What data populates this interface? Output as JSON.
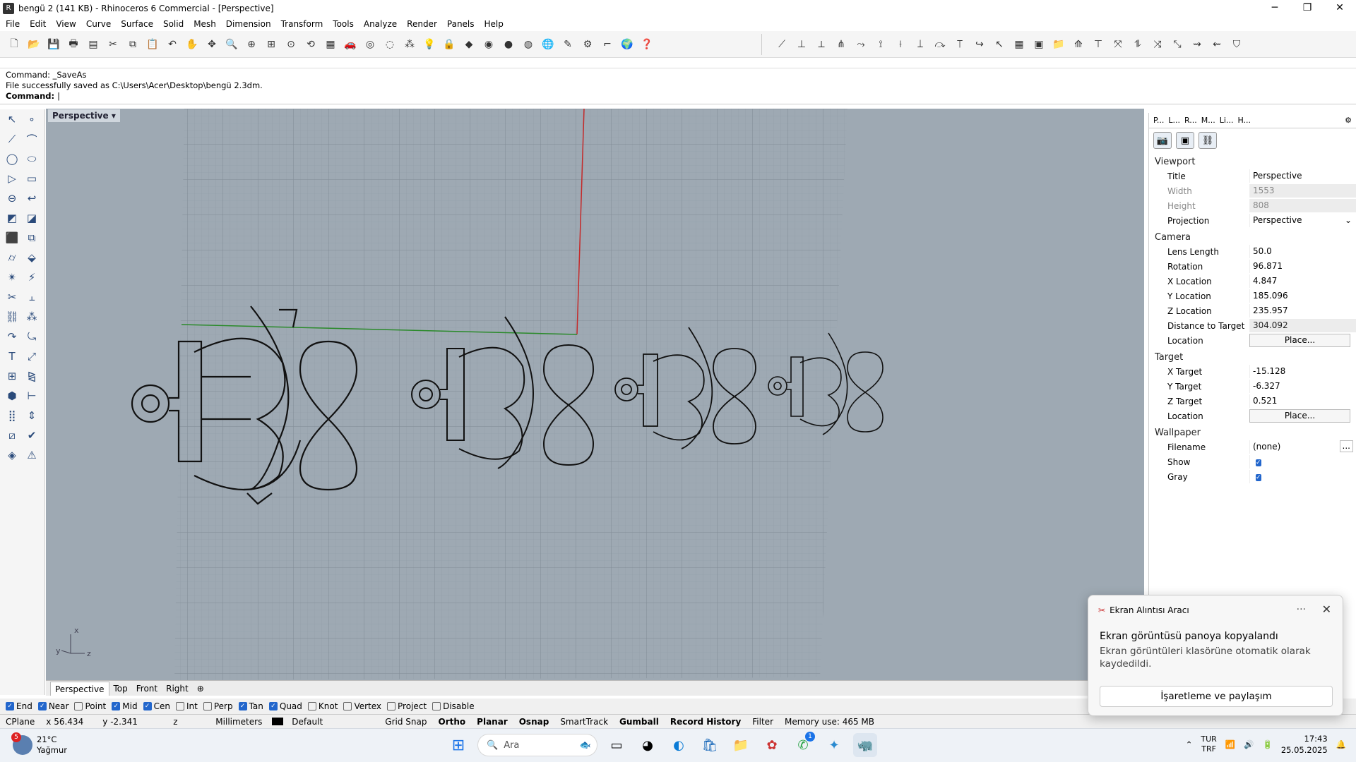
{
  "window": {
    "title": "bengü 2 (141 KB) - Rhinoceros 6 Commercial - [Perspective]",
    "min": "─",
    "max": "❐",
    "close": "✕"
  },
  "menu": [
    "File",
    "Edit",
    "View",
    "Curve",
    "Surface",
    "Solid",
    "Mesh",
    "Dimension",
    "Transform",
    "Tools",
    "Analyze",
    "Render",
    "Panels",
    "Help"
  ],
  "command": {
    "history1": "Command: _SaveAs",
    "history2": "File successfully saved as C:\\Users\\Acer\\Desktop\\bengü 2.3dm.",
    "prompt": "Command:"
  },
  "viewport": {
    "label": "Perspective",
    "axis_x": "x",
    "axis_y": "y",
    "axis_z": "z"
  },
  "viewport_tabs": [
    "Perspective",
    "Top",
    "Front",
    "Right"
  ],
  "osnaps": [
    {
      "label": "End",
      "on": true
    },
    {
      "label": "Near",
      "on": true
    },
    {
      "label": "Point",
      "on": false
    },
    {
      "label": "Mid",
      "on": true
    },
    {
      "label": "Cen",
      "on": true
    },
    {
      "label": "Int",
      "on": false
    },
    {
      "label": "Perp",
      "on": false
    },
    {
      "label": "Tan",
      "on": true
    },
    {
      "label": "Quad",
      "on": true
    },
    {
      "label": "Knot",
      "on": false
    },
    {
      "label": "Vertex",
      "on": false
    },
    {
      "label": "Project",
      "on": false
    },
    {
      "label": "Disable",
      "on": false
    }
  ],
  "status": {
    "cplane": "CPlane",
    "x": "x 56.434",
    "y": "y -2.341",
    "z": "z",
    "units": "Millimeters",
    "layer": "Default",
    "grid_snap": "Grid Snap",
    "ortho": "Ortho",
    "planar": "Planar",
    "osnap": "Osnap",
    "smarttrack": "SmartTrack",
    "gumball": "Gumball",
    "record_history": "Record History",
    "filter": "Filter",
    "memory": "Memory use: 465 MB"
  },
  "panel": {
    "tabs": [
      "P...",
      "L...",
      "R...",
      "M...",
      "Li...",
      "H..."
    ],
    "viewport_header": "Viewport",
    "title_k": "Title",
    "title_v": "Perspective",
    "width_k": "Width",
    "width_v": "1553",
    "height_k": "Height",
    "height_v": "808",
    "projection_k": "Projection",
    "projection_v": "Perspective",
    "camera_header": "Camera",
    "lens_k": "Lens Length",
    "lens_v": "50.0",
    "rotation_k": "Rotation",
    "rotation_v": "96.871",
    "xloc_k": "X Location",
    "xloc_v": "4.847",
    "yloc_k": "Y Location",
    "yloc_v": "185.096",
    "zloc_k": "Z Location",
    "zloc_v": "235.957",
    "dist_k": "Distance to Target",
    "dist_v": "304.092",
    "cam_location_k": "Location",
    "place_label": "Place...",
    "target_header": "Target",
    "xt_k": "X Target",
    "xt_v": "-15.128",
    "yt_k": "Y Target",
    "yt_v": "-6.327",
    "zt_k": "Z Target",
    "zt_v": "0.521",
    "tgt_location_k": "Location",
    "wallpaper_header": "Wallpaper",
    "filename_k": "Filename",
    "filename_v": "(none)",
    "browse": "...",
    "show_k": "Show",
    "gray_k": "Gray"
  },
  "toast": {
    "app": "Ekran Alıntısı Aracı",
    "title": "Ekran görüntüsü panoya kopyalandı",
    "body": "Ekran görüntüleri klasörüne otomatik olarak kaydedildi.",
    "action": "İşaretleme ve paylaşım",
    "dots": "···",
    "close": "✕"
  },
  "taskbar": {
    "temp": "21°C",
    "weather": "Yağmur",
    "weather_badge": "5",
    "search": "Ara",
    "whatsapp_badge": "1",
    "lang1": "TUR",
    "lang2": "TRF",
    "time": "17:43",
    "date": "25.05.2025"
  }
}
